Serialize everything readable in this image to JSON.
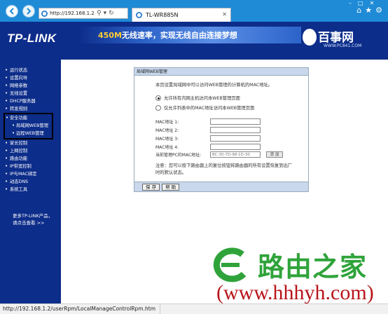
{
  "browser": {
    "url": "http://192.168.1.2/",
    "tab_title": "TL-WR885N",
    "status_url": "http://192.168.1.2/userRpm/LocalManageControlRpm.htm"
  },
  "banner": {
    "logo": "TP-LINK",
    "slogan_highlight": "450M",
    "slogan_rest": "无线速率，实现无线自由连接梦想",
    "site_name": "百事网",
    "site_url": "WWW.PC841.COM"
  },
  "sidebar": {
    "items": [
      "运行状态",
      "设置向导",
      "网络参数",
      "无线设置",
      "DHCP服务器",
      "转发规则"
    ],
    "group_title": "安全功能",
    "group_items": [
      "局域网WEB管理",
      "远程WEB管理"
    ],
    "items_after": [
      "家长控制",
      "上网控制",
      "路由功能",
      "IP带宽控制",
      "IP与MAC绑定",
      "动态DNS",
      "系统工具"
    ],
    "more_line1": "更多TP-LINK产品，",
    "more_line2": "请点击查看 >>"
  },
  "panel": {
    "title": "局域网WEB管理",
    "description": "本页设置局域网中可以访问WEB管理的计算机的MAC地址。",
    "radio1": "允许所有内网主机访问本WEB管理页面",
    "radio2": "仅允许列表中的MAC地址访问本WEB管理页面",
    "mac_labels": [
      "MAC地址 1:",
      "MAC地址 2:",
      "MAC地址 3:",
      "MAC地址 4:"
    ],
    "current_mac_label": "当前管理PC的MAC地址:",
    "current_mac_value": "BC-30-7D-98-1D-30",
    "copy_label": "添 加",
    "note_line1": "注意：您可以按下路由器上的复位按钮将路由器的所有设置恢复到出厂",
    "note_line2": "时的默认状态。",
    "save_label": "保 存",
    "help_label": "帮 助"
  },
  "watermark": {
    "cn": "路由之家",
    "url": "(www.hhhyh.com)"
  },
  "colors": {
    "chrome": "#1f8bd6",
    "navy": "#0d2d8a",
    "panel_head": "#c9d8ec",
    "watermark_green": "#2fa33a",
    "watermark_red": "#b8151b"
  }
}
